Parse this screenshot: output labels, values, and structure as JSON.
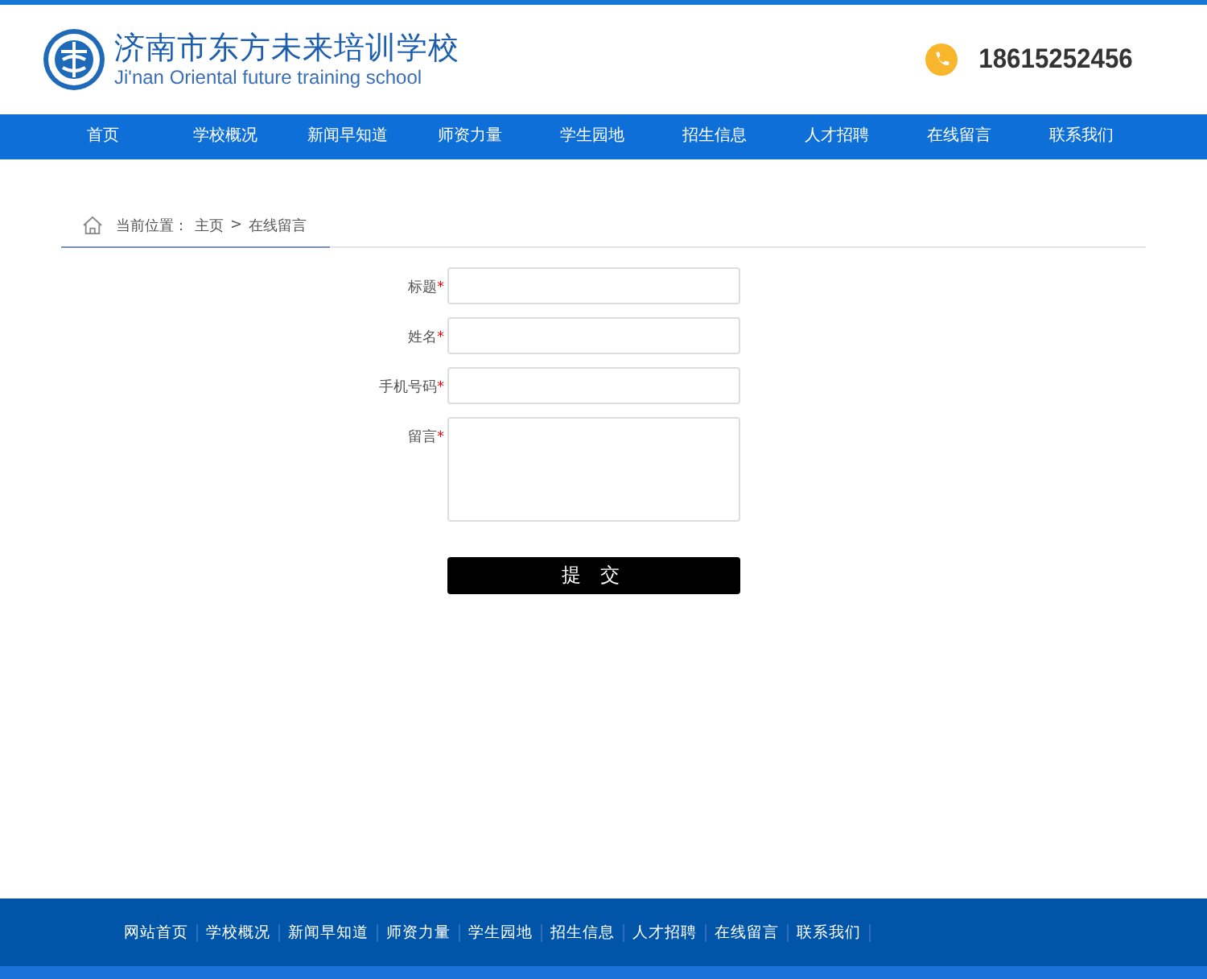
{
  "header": {
    "school_name": "济南市东方未来培训学校",
    "school_name_en": "Ji'nan Oriental future training school",
    "phone": "18615252456"
  },
  "nav": [
    "首页",
    "学校概况",
    "新闻早知道",
    "师资力量",
    "学生园地",
    "招生信息",
    "人才招聘",
    "在线留言",
    "联系我们"
  ],
  "breadcrumb": {
    "label": "当前位置：",
    "items": [
      "主页",
      "在线留言"
    ],
    "separator": ">"
  },
  "form": {
    "fields": [
      {
        "label": "标题",
        "required_mark": "*",
        "kind": "input"
      },
      {
        "label": "姓名",
        "required_mark": "*",
        "kind": "input"
      },
      {
        "label": "手机号码",
        "required_mark": "*",
        "kind": "input"
      },
      {
        "label": "留言",
        "required_mark": "*",
        "kind": "textarea"
      }
    ],
    "submit": "提 交"
  },
  "footer": {
    "links": [
      "网站首页",
      "学校概况",
      "新闻早知道",
      "师资力量",
      "学生园地",
      "招生信息",
      "人才招聘",
      "在线留言",
      "联系我们"
    ]
  }
}
